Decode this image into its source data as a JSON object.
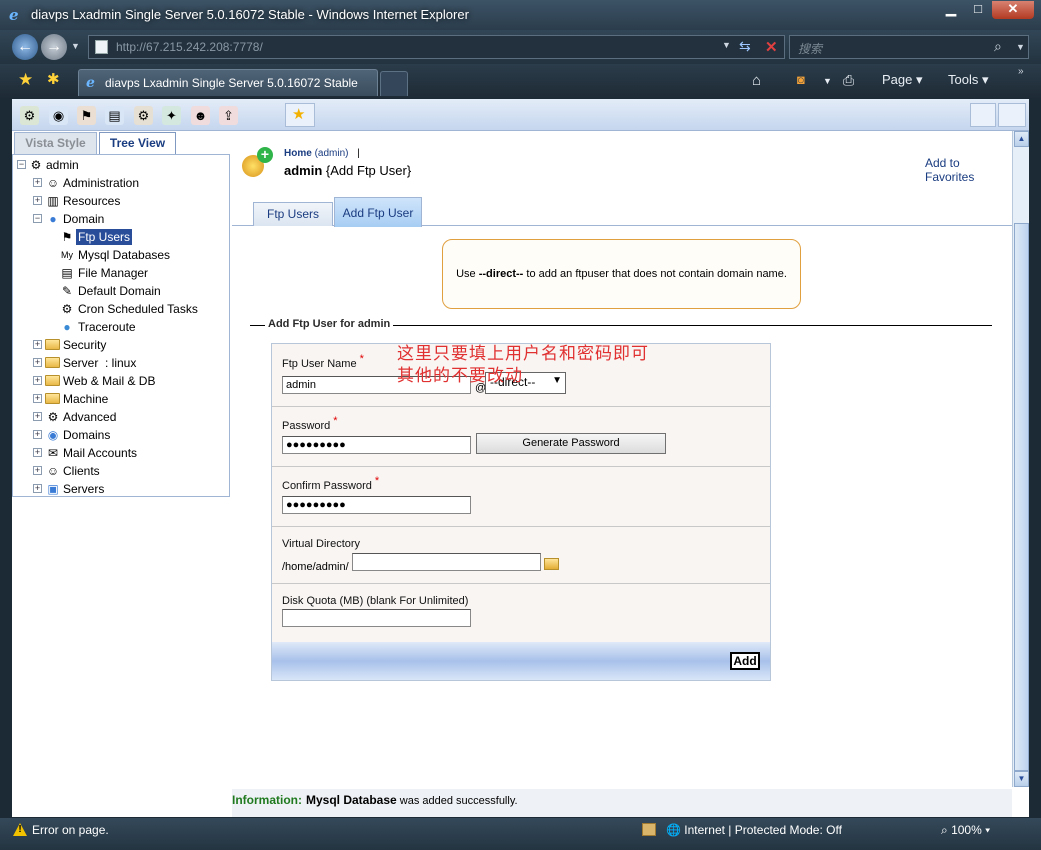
{
  "window": {
    "title": "diavps Lxadmin Single Server 5.0.16072 Stable - Windows Internet Explorer",
    "min_glyph": "▁",
    "max_glyph": "□",
    "close_glyph": "✕"
  },
  "browser": {
    "url": "http://67.215.242.208:7778/",
    "search_placeholder": "搜索",
    "tab_title": "diavps Lxadmin Single Server 5.0.16072 Stable",
    "commands": {
      "page": "Page ▾",
      "tools": "Tools ▾"
    }
  },
  "sidebar": {
    "tabs": {
      "vista": "Vista Style",
      "tree": "Tree View"
    },
    "root": "admin",
    "items": [
      {
        "label": "Administration",
        "icon": "admin-icon"
      },
      {
        "label": "Resources",
        "icon": "resources-icon"
      },
      {
        "label": "Domain",
        "icon": "domain-globe-icon"
      },
      {
        "label": "Ftp Users",
        "icon": "ftp-users-icon",
        "selected": true
      },
      {
        "label": "Mysql Databases",
        "icon": "mysql-icon"
      },
      {
        "label": "File Manager",
        "icon": "file-manager-icon"
      },
      {
        "label": "Default Domain",
        "icon": "default-domain-icon"
      },
      {
        "label": "Cron Scheduled Tasks",
        "icon": "cron-icon"
      },
      {
        "label": "Traceroute",
        "icon": "traceroute-icon"
      },
      {
        "label": "Security",
        "icon": "folder-icon"
      },
      {
        "label": "Server  : linux",
        "icon": "folder-icon"
      },
      {
        "label": "Web & Mail & DB",
        "icon": "folder-icon"
      },
      {
        "label": "Machine",
        "icon": "folder-icon"
      },
      {
        "label": "Advanced",
        "icon": "advanced-icon"
      },
      {
        "label": "Domains",
        "icon": "domains-icon"
      },
      {
        "label": "Mail Accounts",
        "icon": "mail-accounts-icon"
      },
      {
        "label": "Clients",
        "icon": "clients-icon"
      },
      {
        "label": "Servers",
        "icon": "servers-icon"
      }
    ]
  },
  "header": {
    "home": "Home",
    "home_user": "(admin)",
    "separator": "|",
    "title_user": "admin",
    "title_action": "{Add Ftp User}",
    "add_to_favorites": "Add to Favorites"
  },
  "content_tabs": {
    "ftp_users": "Ftp Users",
    "add_ftp_user": "Add Ftp User"
  },
  "notice": {
    "before": "Use ",
    "highlight": "--direct--",
    "after": " to add an ftpuser that does not contain domain name."
  },
  "form": {
    "legend": "Add Ftp User for admin",
    "ftp_user_name_label": "Ftp User Name",
    "ftp_user_name_value": "admin",
    "at_sign": "@",
    "domain_select_value": "--direct--",
    "password_label": "Password",
    "password_value": "●●●●●●●●●",
    "generate_password": "Generate Password",
    "confirm_password_label": "Confirm Password",
    "confirm_password_value": "●●●●●●●●●",
    "virtual_directory_label": "Virtual Directory",
    "virtual_directory_prefix": "/home/admin/",
    "virtual_directory_value": "",
    "disk_quota_label": "Disk Quota (MB) (blank For Unlimited)",
    "disk_quota_value": "",
    "required_mark": "*",
    "submit": "Add"
  },
  "annotation": {
    "line1": "这里只要填上用户名和密码即可",
    "line2": "其他的不要改动"
  },
  "info_bar": {
    "label": "Information:",
    "bold": "Mysql Database",
    "message": " was added successfully."
  },
  "status_bar": {
    "text": "Error on page.",
    "zone": "Internet | Protected Mode: Off",
    "zoom": "100%"
  }
}
